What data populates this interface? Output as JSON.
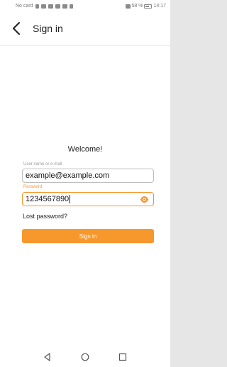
{
  "status_bar": {
    "carrier": "No card",
    "battery": "58 %",
    "time": "14:17"
  },
  "app_bar": {
    "title": "Sign in",
    "back_icon": "chevron-left-icon"
  },
  "form": {
    "welcome": "Welcome!",
    "username": {
      "label": "User name or e-mail",
      "value": "example@example.com"
    },
    "password": {
      "label": "Password",
      "value": "1234567890",
      "visibility_icon": "eye-icon"
    },
    "lost_password": "Lost password?",
    "signin_label": "Sign in"
  },
  "nav_bar": {
    "back_icon": "triangle-back-icon",
    "home_icon": "circle-home-icon",
    "recents_icon": "square-recents-icon"
  },
  "colors": {
    "accent": "#f7982c",
    "text": "#222222",
    "label": "#9a9a9a"
  }
}
